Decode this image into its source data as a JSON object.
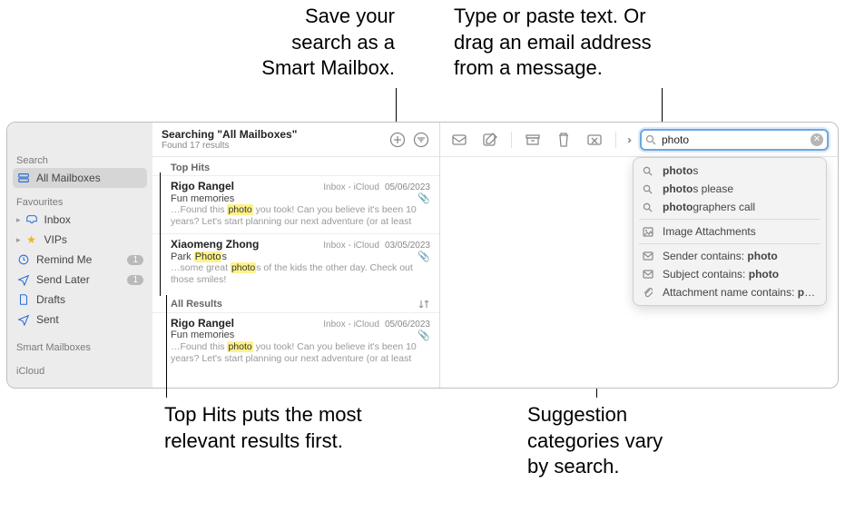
{
  "callouts": {
    "smart_mailbox": "Save your\nsearch as a\nSmart Mailbox.",
    "search_hint": "Type or paste text. Or\ndrag an email address\nfrom a message.",
    "top_hits": "Top Hits puts the most\nrelevant results first.",
    "suggestion_hint": "Suggestion\ncategories vary\nby search."
  },
  "sidebar": {
    "search_heading": "Search",
    "favourites_heading": "Favourites",
    "smart_heading": "Smart Mailboxes",
    "icloud_heading": "iCloud",
    "items": [
      {
        "label": "All Mailboxes"
      },
      {
        "label": "Inbox"
      },
      {
        "label": "VIPs"
      },
      {
        "label": "Remind Me",
        "badge": "1"
      },
      {
        "label": "Send Later",
        "badge": "1"
      },
      {
        "label": "Drafts"
      },
      {
        "label": "Sent"
      }
    ]
  },
  "list": {
    "title": "Searching \"All Mailboxes\"",
    "subtitle": "Found 17 results",
    "top_hits_label": "Top Hits",
    "all_results_label": "All Results",
    "messages": [
      {
        "sender": "Rigo Rangel",
        "mailbox": "Inbox - iCloud",
        "date": "05/06/2023",
        "subject": "Fun memories",
        "preview_pre": "…Found this ",
        "preview_hl": "photo",
        "preview_post": " you took! Can you believe it's been 10 years? Let's start planning our next adventure (or at least plan to get t…"
      },
      {
        "sender": "Xiaomeng Zhong",
        "mailbox": "Inbox - iCloud",
        "date": "03/05/2023",
        "subject_pre": "Park ",
        "subject_hl": "Photo",
        "subject_post": "s",
        "preview_pre": "…some great ",
        "preview_hl": "photo",
        "preview_post": "s of the kids the other day. Check out those smiles!"
      },
      {
        "sender": "Rigo Rangel",
        "mailbox": "Inbox - iCloud",
        "date": "05/06/2023",
        "subject": "Fun memories",
        "preview_pre": "…Found this ",
        "preview_hl": "photo",
        "preview_post": " you took! Can you believe it's been 10 years? Let's start planning our next adventure (or at least plan to get t…"
      }
    ]
  },
  "search": {
    "value": "photo",
    "placeholder": "Search"
  },
  "suggestions": {
    "items": [
      {
        "icon": "mag",
        "label_pre": "",
        "label_bold": "photo",
        "label_post": "s"
      },
      {
        "icon": "mag",
        "label_pre": "",
        "label_bold": "photo",
        "label_post": "s please"
      },
      {
        "icon": "mag",
        "label_pre": "",
        "label_bold": "photo",
        "label_post": "graphers call"
      },
      {
        "icon": "img",
        "label_pre": "Image Attachments",
        "label_bold": "",
        "label_post": ""
      },
      {
        "icon": "env",
        "label_pre": "Sender contains: ",
        "label_bold": "photo",
        "label_post": ""
      },
      {
        "icon": "env",
        "label_pre": "Subject contains: ",
        "label_bold": "photo",
        "label_post": ""
      },
      {
        "icon": "clip",
        "label_pre": "Attachment name contains: ",
        "label_bold": "photo",
        "label_post": ""
      }
    ]
  }
}
